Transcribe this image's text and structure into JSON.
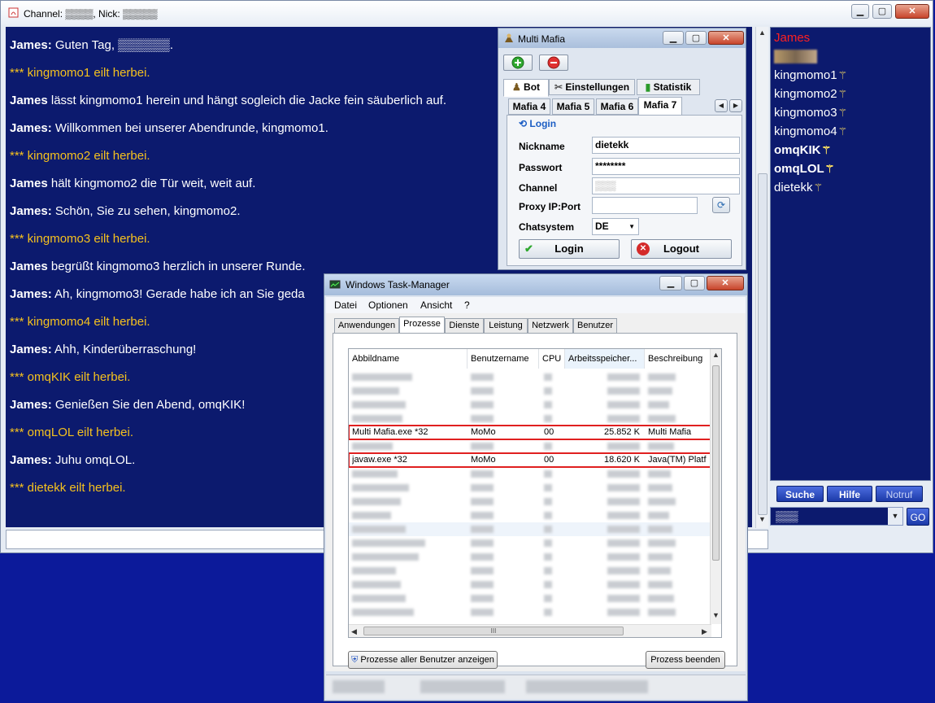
{
  "chat_window": {
    "title": "Channel: ▒▒▒▒,  Nick: ▒▒▒▒▒",
    "caption_minimize": "▁",
    "caption_maximize": "▢",
    "caption_close": "✕",
    "messages": [
      {
        "speaker": "James:",
        "text": " Guten Tag, ▒▒▒▒▒▒.",
        "system": false
      },
      {
        "speaker": "",
        "text": "*** kingmomo1 eilt herbei.",
        "system": true
      },
      {
        "speaker": "James",
        "text": " lässt kingmomo1 herein und hängt sogleich die Jacke fein säuberlich auf.",
        "system": false
      },
      {
        "speaker": "James:",
        "text": " Willkommen bei unserer Abendrunde, kingmomo1.",
        "system": false
      },
      {
        "speaker": "",
        "text": "*** kingmomo2 eilt herbei.",
        "system": true
      },
      {
        "speaker": "James",
        "text": " hält kingmomo2 die Tür weit, weit auf.",
        "system": false
      },
      {
        "speaker": "James:",
        "text": " Schön, Sie zu sehen, kingmomo2.",
        "system": false
      },
      {
        "speaker": "",
        "text": "*** kingmomo3 eilt herbei.",
        "system": true
      },
      {
        "speaker": "James",
        "text": " begrüßt kingmomo3 herzlich in unserer Runde.",
        "system": false
      },
      {
        "speaker": "James:",
        "text": " Ah, kingmomo3! Gerade habe ich an Sie geda",
        "system": false
      },
      {
        "speaker": "",
        "text": "*** kingmomo4 eilt herbei.",
        "system": true
      },
      {
        "speaker": "James:",
        "text": " Ahh, Kinderüberraschung!",
        "system": false
      },
      {
        "speaker": "",
        "text": "*** omqKIK eilt herbei.",
        "system": true
      },
      {
        "speaker": "James:",
        "text": " Genießen Sie den Abend, omqKIK!",
        "system": false
      },
      {
        "speaker": "",
        "text": "*** omqLOL eilt herbei.",
        "system": true
      },
      {
        "speaker": "James:",
        "text": " Juhu omqLOL.",
        "system": false
      },
      {
        "speaker": "",
        "text": "*** dietekk eilt herbei.",
        "system": true
      }
    ],
    "users": [
      {
        "name": "James",
        "style": "red"
      },
      {
        "name": "▒▒▒▒▒",
        "style": "blur"
      },
      {
        "name": "kingmomo1",
        "style": "normal"
      },
      {
        "name": "kingmomo2",
        "style": "normal"
      },
      {
        "name": "kingmomo3",
        "style": "normal"
      },
      {
        "name": "kingmomo4",
        "style": "normal"
      },
      {
        "name": "omqKIK",
        "style": "bold"
      },
      {
        "name": "omqLOL",
        "style": "bold"
      },
      {
        "name": "dietekk",
        "style": "normal"
      }
    ],
    "buttons": {
      "search": "Suche",
      "help": "Hilfe",
      "emergency": "Notruf",
      "go": "GO"
    },
    "nick_combo_value": "▒▒▒"
  },
  "multi_mafia": {
    "title": "Multi Mafia",
    "add_icon": "plus-circle-icon",
    "remove_icon": "minus-circle-icon",
    "main_tabs": [
      "Bot",
      "Einstellungen",
      "Statistik"
    ],
    "mafia_tabs": [
      "Mafia 4",
      "Mafia 5",
      "Mafia 6",
      "Mafia 7"
    ],
    "login_section_title": "Login",
    "fields": {
      "nickname_label": "Nickname",
      "nickname_value": "dietekk",
      "password_label": "Passwort",
      "password_value": "********",
      "channel_label": "Channel",
      "channel_value": "▒▒▒",
      "proxy_label": "Proxy IP:Port",
      "proxy_value": "",
      "chatsystem_label": "Chatsystem",
      "chatsystem_value": "DE"
    },
    "login_button": "Login",
    "logout_button": "Logout"
  },
  "task_manager": {
    "title": "Windows Task-Manager",
    "menu": [
      "Datei",
      "Optionen",
      "Ansicht",
      "?"
    ],
    "tabs": [
      "Anwendungen",
      "Prozesse",
      "Dienste",
      "Leistung",
      "Netzwerk",
      "Benutzer"
    ],
    "active_tab": "Prozesse",
    "columns": [
      "Abbildname",
      "Benutzername",
      "CPU",
      "Arbeitsspeicher...",
      "Beschreibung"
    ],
    "highlighted_rows": [
      {
        "image": "Multi Mafia.exe *32",
        "user": "MoMo",
        "cpu": "00",
        "memory": "25.852 K",
        "description": "Multi Mafia"
      },
      {
        "image": "javaw.exe *32",
        "user": "MoMo",
        "cpu": "00",
        "memory": "18.620 K",
        "description": "Java(TM) Platf"
      }
    ],
    "show_all_button": "Prozesse aller Benutzer anzeigen",
    "end_process_button": "Prozess beenden",
    "hscroll_grip": "III"
  }
}
